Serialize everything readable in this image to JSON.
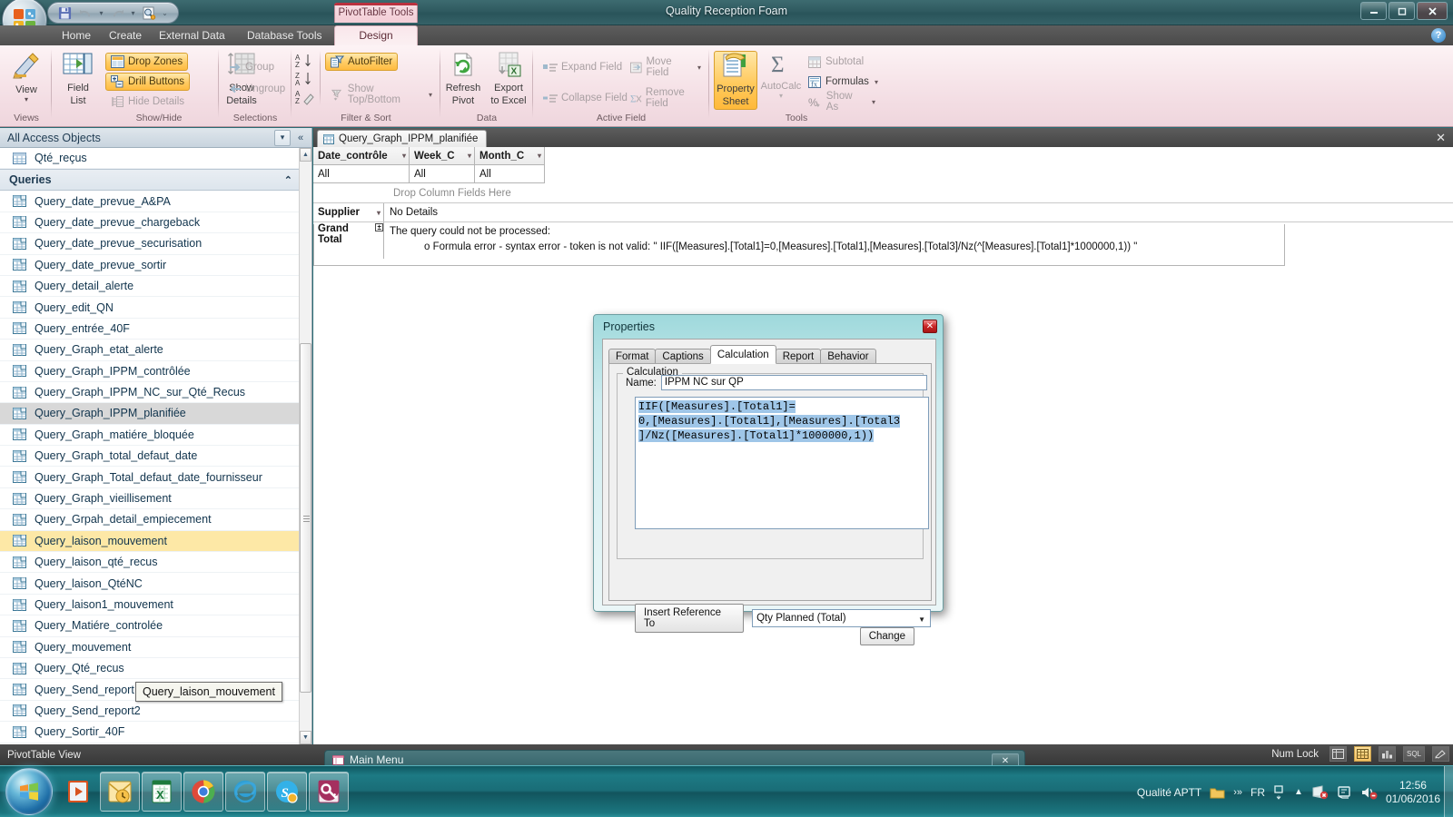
{
  "window": {
    "title": "Quality Reception Foam",
    "contextual_tab_label": "PivotTable Tools",
    "minimize": "–",
    "maximize": "❐",
    "close": "✕",
    "help_icon": "?"
  },
  "quick_access": {
    "save_icon": "save-icon",
    "undo_icon": "undo-icon",
    "redo_icon": "redo-icon",
    "print_preview_icon": "print-preview-icon",
    "customize_icon": "customize-qat-icon"
  },
  "ribbon": {
    "tabs": [
      {
        "label": "Home",
        "active": false
      },
      {
        "label": "Create",
        "active": false
      },
      {
        "label": "External Data",
        "active": false
      },
      {
        "label": "Database Tools",
        "active": false
      },
      {
        "label": "Design",
        "active": true
      }
    ],
    "groups": [
      {
        "name": "Views",
        "buttons": [
          {
            "label": "View",
            "icon": "view-design-icon",
            "has_caret": true,
            "selected": false
          }
        ]
      },
      {
        "name": "Show/Hide",
        "big": [
          {
            "label": "Field\nList",
            "label_line1": "Field",
            "label_line2": "List",
            "icon": "field-list-icon"
          },
          {
            "label": "Show\nDetails",
            "label_line1": "Show",
            "label_line2": "Details",
            "icon": "show-details-icon"
          }
        ],
        "small": [
          {
            "label": "Drop Zones",
            "icon": "drop-zones-icon",
            "selected": true,
            "disabled": false
          },
          {
            "label": "Drill Buttons",
            "icon": "drill-buttons-icon",
            "selected": true,
            "disabled": false
          },
          {
            "label": "Hide Details",
            "icon": "hide-details-icon",
            "selected": false,
            "disabled": true
          }
        ]
      },
      {
        "name": "Selections",
        "small": [
          {
            "label": "Group",
            "icon": "group-icon",
            "disabled": true
          },
          {
            "label": "Ungroup",
            "icon": "ungroup-icon",
            "disabled": true
          }
        ]
      },
      {
        "name": "Filter & Sort",
        "sort_icons": [
          "sort-az-icon",
          "sort-za-icon",
          "clear-sort-icon"
        ],
        "small": [
          {
            "label": "AutoFilter",
            "icon": "autofilter-icon",
            "selected": true,
            "disabled": false
          },
          {
            "label": "Show Top/Bottom",
            "icon": "show-top-bottom-icon",
            "selected": false,
            "disabled": true,
            "has_caret": true
          }
        ]
      },
      {
        "name": "Data",
        "big": [
          {
            "label_line1": "Refresh",
            "label_line2": "Pivot",
            "icon": "refresh-pivot-icon"
          },
          {
            "label_line1": "Export",
            "label_line2": "to Excel",
            "icon": "export-excel-icon"
          }
        ]
      },
      {
        "name": "Active Field",
        "small": [
          {
            "label": "Expand Field",
            "icon": "expand-field-icon",
            "disabled": true
          },
          {
            "label": "Move Field",
            "icon": "move-field-icon",
            "disabled": true,
            "has_caret": true
          },
          {
            "label": "Collapse Field",
            "icon": "collapse-field-icon",
            "disabled": true
          },
          {
            "label": "Remove Field",
            "icon": "remove-field-icon",
            "disabled": true
          }
        ]
      },
      {
        "name": "Tools",
        "big": [
          {
            "label_line1": "Property",
            "label_line2": "Sheet",
            "icon": "property-sheet-icon",
            "selected": true
          },
          {
            "label_line1": "AutoCalc",
            "label_line2": "",
            "icon": "autocalc-sigma-icon",
            "disabled": true,
            "has_caret": true
          }
        ],
        "small": [
          {
            "label": "Subtotal",
            "icon": "subtotal-icon",
            "disabled": true
          },
          {
            "label": "Formulas",
            "icon": "formulas-icon",
            "disabled": false,
            "has_caret": true
          },
          {
            "label": "Show As",
            "icon": "show-as-icon",
            "disabled": true,
            "has_caret": true
          }
        ]
      }
    ]
  },
  "navpane": {
    "header": "All Access Objects",
    "header_dropdown_icon": "chevron-down-circle-icon",
    "collapse_icon": "double-chevron-left-icon",
    "group_label": "Queries",
    "group_collapse_icon": "double-chevron-up-icon",
    "top_item": {
      "label": "Qté_reçus",
      "icon": "table-icon"
    },
    "items": [
      {
        "label": "Query_date_prevue_A&PA",
        "state": ""
      },
      {
        "label": "Query_date_prevue_chargeback",
        "state": ""
      },
      {
        "label": "Query_date_prevue_securisation",
        "state": ""
      },
      {
        "label": "Query_date_prevue_sortir",
        "state": ""
      },
      {
        "label": "Query_detail_alerte",
        "state": ""
      },
      {
        "label": "Query_edit_QN",
        "state": ""
      },
      {
        "label": "Query_entrée_40F",
        "state": ""
      },
      {
        "label": "Query_Graph_etat_alerte",
        "state": ""
      },
      {
        "label": "Query_Graph_IPPM_contrôlée",
        "state": ""
      },
      {
        "label": "Query_Graph_IPPM_NC_sur_Qté_Recus",
        "state": ""
      },
      {
        "label": "Query_Graph_IPPM_planifiée",
        "state": "selected"
      },
      {
        "label": "Query_Graph_matiére_bloquée",
        "state": ""
      },
      {
        "label": "Query_Graph_total_defaut_date",
        "state": ""
      },
      {
        "label": "Query_Graph_Total_defaut_date_fournisseur",
        "state": ""
      },
      {
        "label": "Query_Graph_vieillisement",
        "state": ""
      },
      {
        "label": "Query_Grpah_detail_empiecement",
        "state": ""
      },
      {
        "label": "Query_laison_mouvement",
        "state": "hover"
      },
      {
        "label": "Query_laison_qté_recus",
        "state": ""
      },
      {
        "label": "Query_laison_QtéNC",
        "state": ""
      },
      {
        "label": "Query_laison1_mouvement",
        "state": ""
      },
      {
        "label": "Query_Matiére_controlée",
        "state": ""
      },
      {
        "label": "Query_mouvement",
        "state": ""
      },
      {
        "label": "Query_Qté_recus",
        "state": ""
      },
      {
        "label": "Query_Send_report",
        "state": ""
      },
      {
        "label": "Query_Send_report2",
        "state": ""
      },
      {
        "label": "Query_Sortir_40F",
        "state": ""
      }
    ],
    "tooltip": "Query_laison_mouvement"
  },
  "document": {
    "tab_label": "Query_Graph_IPPM_planifiée",
    "tab_icon": "query-icon",
    "close_icon": "close-icon",
    "filter_fields": [
      {
        "name": "Date_contrôle",
        "value": "All"
      },
      {
        "name": "Week_C",
        "value": "All"
      },
      {
        "name": "Month_C",
        "value": "All"
      }
    ],
    "drop_column_label": "Drop Column Fields Here",
    "row_field": "Supplier",
    "no_details": "No Details",
    "grand_total": "Grand Total",
    "error_line1": "The query could not be processed:",
    "error_line2": "o Formula error - syntax error - token is not valid: \"  IIF([Measures].[Total1]=0,[Measures].[Total1],[Measures].[Total3]/Nz(^[Measures].[Total1]*1000000,1))   \""
  },
  "properties_dialog": {
    "title": "Properties",
    "close_label": "✕",
    "tabs": [
      {
        "label": "Format",
        "active": false
      },
      {
        "label": "Captions",
        "active": false
      },
      {
        "label": "Calculation",
        "active": true
      },
      {
        "label": "Report",
        "active": false
      },
      {
        "label": "Behavior",
        "active": false
      }
    ],
    "group_legend": "Calculation",
    "name_label": "Name:",
    "name_value": "IPPM NC sur QP",
    "formula_line1": "IIF([Measures].[Total1]=",
    "formula_line2": "0,[Measures].[Total1],[Measures].[Total3",
    "formula_line3": "]/Nz([Measures].[Total1]*1000000,1))",
    "insert_reference_label": "Insert Reference To",
    "dropdown_value": "Qty Planned (Total)",
    "dropdown_arrow_icon": "chevron-down-icon",
    "change_label": "Change"
  },
  "statusbar": {
    "view_label": "PivotTable View",
    "num_lock": "Num Lock",
    "view_buttons": [
      {
        "icon": "datasheet-view-icon",
        "active": false
      },
      {
        "icon": "pivottable-view-icon",
        "active": true
      },
      {
        "icon": "pivotchart-view-icon",
        "active": false
      },
      {
        "icon": "sql-view-icon",
        "active": false
      },
      {
        "icon": "design-view-icon",
        "active": false
      }
    ]
  },
  "background_window": {
    "title": "Main Menu",
    "icon": "form-icon",
    "close_label": "✕"
  },
  "taskbar": {
    "start_icon": "windows-start-icon",
    "items": [
      {
        "icon": "windows-media-player-icon",
        "framed": false
      },
      {
        "icon": "outlook-icon",
        "framed": true
      },
      {
        "icon": "excel-icon",
        "framed": true
      },
      {
        "icon": "chrome-icon",
        "framed": true
      },
      {
        "icon": "internet-explorer-icon",
        "framed": true
      },
      {
        "icon": "skype-icon",
        "framed": true
      },
      {
        "icon": "access-icon",
        "framed": true
      }
    ],
    "tray": {
      "user": "Qualité APTT",
      "folder_icon": "folder-icon",
      "overflow_icon": "chevron-double-right-icon",
      "language": "FR",
      "keyboard_icon": "keyboard-layout-icon",
      "show_hidden_icon": "chevron-up-icon",
      "network_icon": "network-error-icon",
      "flag_icon": "action-center-icon",
      "volume_icon": "volume-muted-icon",
      "time": "12:56",
      "date": "01/06/2016"
    }
  }
}
